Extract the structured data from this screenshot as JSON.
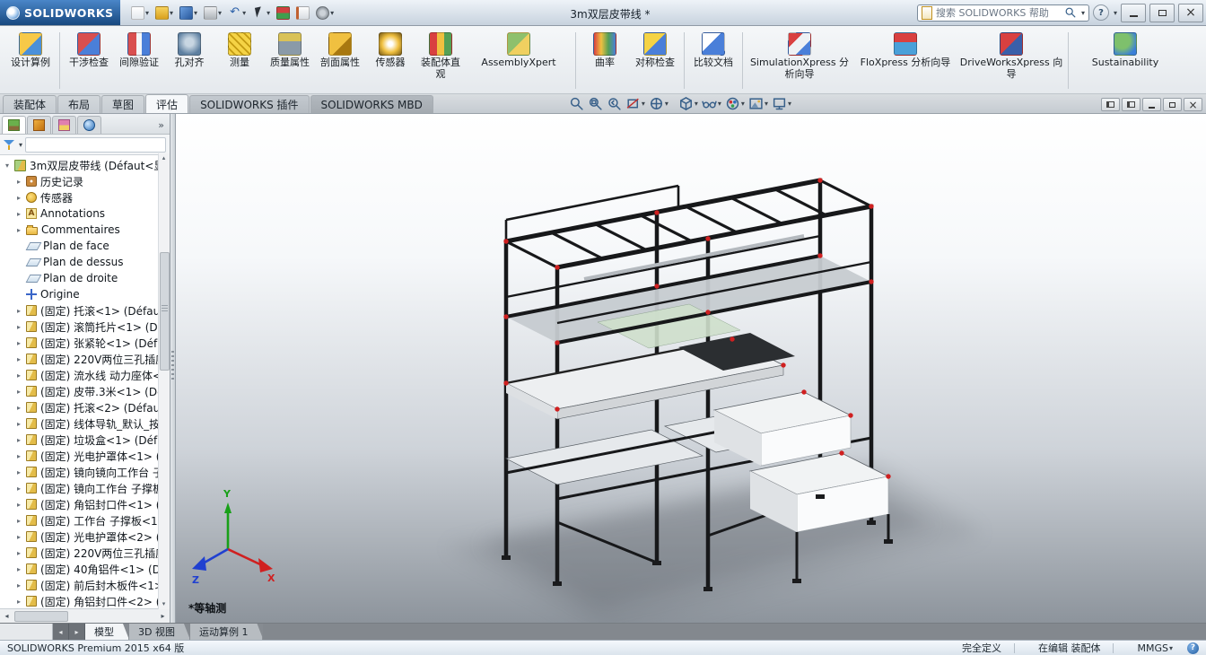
{
  "titlebar": {
    "brand": "SOLIDWORKS",
    "title": "3m双层皮带线 *",
    "search_placeholder": "搜索 SOLIDWORKS 帮助",
    "quick_icons": [
      "new-document",
      "open",
      "save",
      "print",
      "undo",
      "select-arrow",
      "rebuild",
      "new-window",
      "options"
    ],
    "window_icons": [
      "help",
      "minimize",
      "maximize",
      "close"
    ]
  },
  "ribbon": {
    "groups": [
      {
        "items": [
          {
            "icon": "design-study",
            "label": "设计算例"
          }
        ]
      },
      {
        "items": [
          {
            "icon": "interference",
            "label": "干涉检查"
          },
          {
            "icon": "clearance",
            "label": "间隙验证"
          },
          {
            "icon": "hole-align",
            "label": "孔对齐"
          },
          {
            "icon": "measure",
            "label": "测量"
          },
          {
            "icon": "mass-props",
            "label": "质量属性"
          },
          {
            "icon": "section-props",
            "label": "剖面属性"
          },
          {
            "icon": "sensor",
            "label": "传感器"
          },
          {
            "icon": "assembly-visualize",
            "label": "装配体直观"
          },
          {
            "icon": "assembly-xpert",
            "label": "AssemblyXpert"
          }
        ]
      },
      {
        "items": [
          {
            "icon": "curvature",
            "label": "曲率"
          },
          {
            "icon": "symmetry-check",
            "label": "对称检查"
          }
        ]
      },
      {
        "items": [
          {
            "icon": "compare-docs",
            "label": "比较文档"
          }
        ]
      },
      {
        "items": [
          {
            "icon": "simulationxpress",
            "label": "SimulationXpress 分析向导"
          },
          {
            "icon": "floxpress",
            "label": "FloXpress 分析向导"
          },
          {
            "icon": "driveworksxpress",
            "label": "DriveWorksXpress 向导"
          }
        ]
      },
      {
        "items": [
          {
            "icon": "sustainability",
            "label": "Sustainability"
          }
        ]
      }
    ]
  },
  "command_tabs": [
    {
      "label": "装配体"
    },
    {
      "label": "布局"
    },
    {
      "label": "草图"
    },
    {
      "label": "评估"
    },
    {
      "label": "SOLIDWORKS 插件"
    },
    {
      "label": "SOLIDWORKS MBD"
    }
  ],
  "viewbar_icons": [
    "zoom-fit",
    "zoom-area",
    "previous-view",
    "section-view",
    "view-orientation",
    "display-style",
    "hide-show-items",
    "edit-appearance",
    "apply-scene",
    "view-settings"
  ],
  "feature_tree": {
    "panel_tabs": [
      "feature-manager",
      "property-manager",
      "configuration-manager",
      "display-manager"
    ],
    "root": {
      "label": "3m双层皮带线 (Défaut<显"
    },
    "items": [
      {
        "icon": "history",
        "label": "历史记录"
      },
      {
        "icon": "sensors",
        "label": "传感器"
      },
      {
        "icon": "annotations",
        "label": "Annotations"
      },
      {
        "icon": "comments",
        "label": "Commentaires"
      },
      {
        "icon": "plane",
        "label": "Plan de face"
      },
      {
        "icon": "plane",
        "label": "Plan de dessus"
      },
      {
        "icon": "plane",
        "label": "Plan de droite"
      },
      {
        "icon": "origin",
        "label": "Origine"
      },
      {
        "icon": "part",
        "label": "(固定) 托滚<1> (Défaut"
      },
      {
        "icon": "part",
        "label": "(固定) 滚筒托片<1> (Dé"
      },
      {
        "icon": "part",
        "label": "(固定) 张紧轮<1> (Défa"
      },
      {
        "icon": "part",
        "label": "(固定) 220V两位三孔插座"
      },
      {
        "icon": "part",
        "label": "(固定) 流水线 动力座体<"
      },
      {
        "icon": "part",
        "label": "(固定) 皮带.3米<1> (Dé"
      },
      {
        "icon": "part",
        "label": "(固定) 托滚<2> (Défaut"
      },
      {
        "icon": "part",
        "label": "(固定) 线体导轨_默认_按"
      },
      {
        "icon": "part",
        "label": "(固定) 垃圾盒<1> (Défa"
      },
      {
        "icon": "part",
        "label": "(固定) 光电护罩体<1> ("
      },
      {
        "icon": "part",
        "label": "(固定) 镜向镜向工作台 子"
      },
      {
        "icon": "part",
        "label": "(固定) 镜向工作台 子撑板"
      },
      {
        "icon": "part",
        "label": "(固定) 角铝封口件<1> ("
      },
      {
        "icon": "part",
        "label": "(固定) 工作台 子撑板<1"
      },
      {
        "icon": "part",
        "label": "(固定) 光电护罩体<2> ("
      },
      {
        "icon": "part",
        "label": "(固定) 220V两位三孔插座"
      },
      {
        "icon": "part",
        "label": "(固定) 40角铝件<1> (Dé"
      },
      {
        "icon": "part",
        "label": "(固定) 前后封木板件<1>"
      },
      {
        "icon": "part",
        "label": "(固定) 角铝封口件<2> ("
      }
    ]
  },
  "viewport": {
    "view_label": "*等轴测",
    "triad": {
      "x": "X",
      "y": "Y",
      "z": "Z"
    }
  },
  "doc_tabs": [
    {
      "label": "模型"
    },
    {
      "label": "3D 视图"
    },
    {
      "label": "运动算例 1"
    }
  ],
  "statusbar": {
    "app_version": "SOLIDWORKS Premium 2015 x64 版",
    "definition_state": "完全定义",
    "edit_mode": "在编辑 装配体",
    "units": "MMGS"
  },
  "colors": {
    "accent_blue": "#2a6fb8",
    "marker_red": "#cf2020",
    "frame_dark": "#17181a"
  }
}
